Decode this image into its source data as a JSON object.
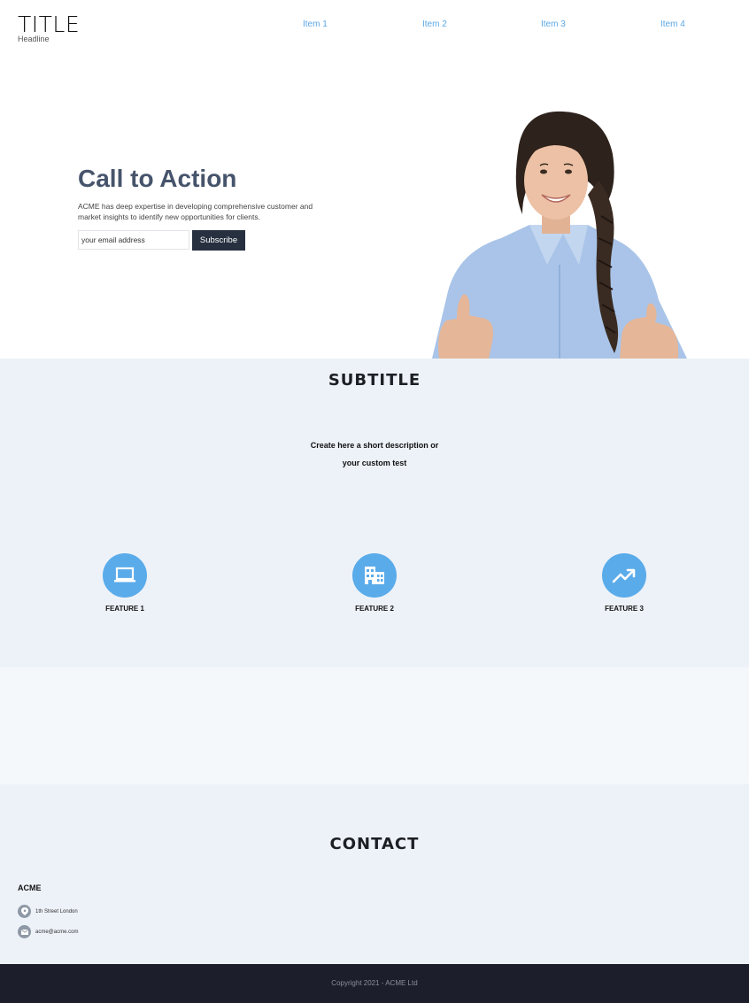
{
  "header": {
    "title": "TITLE",
    "headline": "Headline",
    "nav": [
      "Item 1",
      "Item 2",
      "Item 3",
      "Item 4"
    ],
    "nav_color": "#5aa7e6"
  },
  "hero": {
    "heading": "Call to Action",
    "text": "ACME has deep expertise in developing comprehensive customer and market insights to identify new opportunities for clients.",
    "email_placeholder": "your email address",
    "subscribe_label": "Subscribe",
    "heading_color": "#46546b"
  },
  "features": {
    "title": "SUBTITLE",
    "description_line1": "Create here a short description or",
    "description_line2": "your custom test",
    "items": [
      {
        "label": "FEATURE 1",
        "icon": "laptop-icon"
      },
      {
        "label": "FEATURE 2",
        "icon": "building-icon"
      },
      {
        "label": "FEATURE 3",
        "icon": "trending-up-icon"
      }
    ],
    "accent": "#5aabea"
  },
  "contact": {
    "title": "CONTACT",
    "company": "ACME",
    "address": "1th Street London",
    "email": "acme@acme.com"
  },
  "footer": {
    "copyright": "Copyright 2021 - ACME Ltd"
  }
}
